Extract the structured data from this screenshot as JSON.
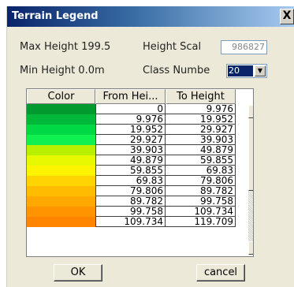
{
  "window": {
    "title": "Terrain Legend",
    "close_label": "X"
  },
  "info": {
    "max_height": "Max Height 199.5",
    "height_scale_label": "Height Scal",
    "height_scale_value": "986827",
    "min_height": "Min Height 0.0m",
    "class_number_label": "Class Numbe",
    "class_number_value": "20"
  },
  "table": {
    "headers": [
      "Color",
      "From Hei...",
      "To Height"
    ],
    "rows": [
      {
        "color": "#009a2e",
        "from": "0",
        "to": "9.976"
      },
      {
        "color": "#00b83a",
        "from": "9.976",
        "to": "19.952"
      },
      {
        "color": "#00d846",
        "from": "19.952",
        "to": "29.927"
      },
      {
        "color": "#10f050",
        "from": "29.927",
        "to": "39.903"
      },
      {
        "color": "#b8f000",
        "from": "39.903",
        "to": "49.879"
      },
      {
        "color": "#e8f800",
        "from": "49.879",
        "to": "59.855"
      },
      {
        "color": "#fff400",
        "from": "59.855",
        "to": "69.83"
      },
      {
        "color": "#ffd400",
        "from": "69.83",
        "to": "79.806"
      },
      {
        "color": "#ffbc00",
        "from": "79.806",
        "to": "89.782"
      },
      {
        "color": "#ffa800",
        "from": "89.782",
        "to": "99.758"
      },
      {
        "color": "#ff9400",
        "from": "99.758",
        "to": "109.734"
      },
      {
        "color": "#ff8400",
        "from": "109.734",
        "to": "119.709"
      }
    ]
  },
  "buttons": {
    "ok": "OK",
    "cancel": "cancel"
  },
  "icons": {
    "scroll_up": "arrow-up-icon",
    "scroll_down": "arrow-down-icon",
    "dropdown": "chevron-down-icon"
  }
}
